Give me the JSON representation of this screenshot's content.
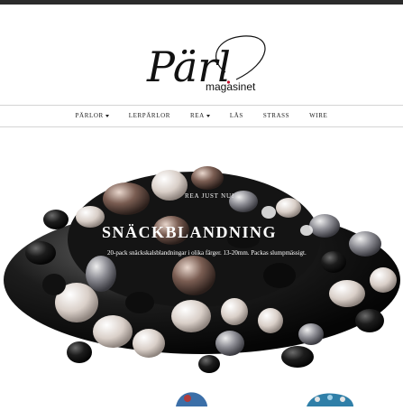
{
  "logo": {
    "main": "Pärl",
    "sub": "magasinet"
  },
  "nav": {
    "items": [
      {
        "label": "PÄRLOR",
        "dropdown": true
      },
      {
        "label": "LERPÄRLOR",
        "dropdown": false
      },
      {
        "label": "REA",
        "dropdown": true
      },
      {
        "label": "LÅS",
        "dropdown": false
      },
      {
        "label": "STRASS",
        "dropdown": false
      },
      {
        "label": "WIRE",
        "dropdown": false
      }
    ]
  },
  "hero": {
    "kicker": "REA JUST NU!",
    "title": "SNÄCKBLANDNING",
    "subtitle": "20-pack snäckskalsblandningar i olika färger. 13-20mm. Packas slumpmässigt."
  },
  "colors": {
    "accent": "#c8102e",
    "text": "#222222",
    "divider": "#d4d4d4"
  }
}
